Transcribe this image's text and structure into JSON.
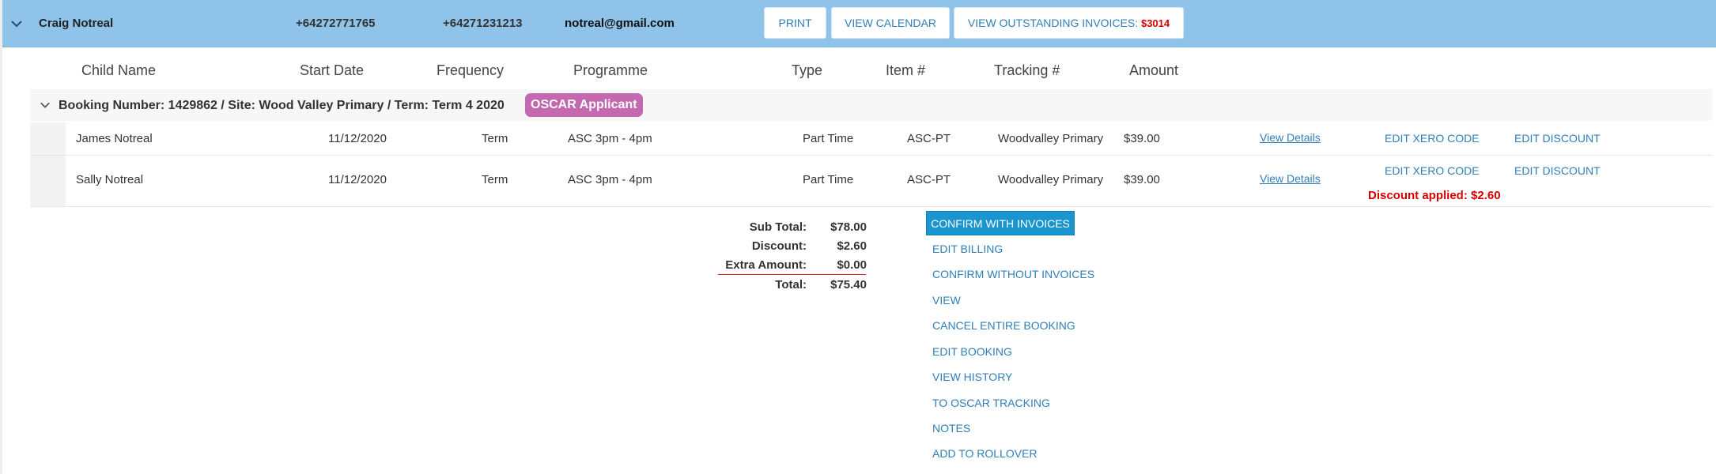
{
  "header": {
    "name": "Craig Notreal",
    "phone1": "+64272771765",
    "phone2": "+64271231213",
    "email": "notreal@gmail.com",
    "buttons": {
      "print": "PRINT",
      "view_calendar": "VIEW CALENDAR",
      "outstanding_label": "VIEW OUTSTANDING INVOICES:",
      "outstanding_amount": "$3014"
    }
  },
  "columns": [
    "Child Name",
    "Start Date",
    "Frequency",
    "Programme",
    "Type",
    "Item #",
    "Tracking #",
    "Amount"
  ],
  "booking": {
    "title": "Booking Number: 1429862 / Site: Wood Valley Primary / Term: Term 4 2020",
    "badge": "OSCAR Applicant"
  },
  "rows": [
    {
      "child": "James Notreal",
      "start_date": "11/12/2020",
      "frequency": "Term",
      "programme": "ASC 3pm - 4pm",
      "type": "Part Time",
      "item": "ASC-PT",
      "tracking": "Woodvalley Primary",
      "amount": "$39.00",
      "view_details": "View Details",
      "edit_xero": "EDIT XERO CODE",
      "edit_discount": "EDIT DISCOUNT"
    },
    {
      "child": "Sally Notreal",
      "start_date": "11/12/2020",
      "frequency": "Term",
      "programme": "ASC 3pm - 4pm",
      "type": "Part Time",
      "item": "ASC-PT",
      "tracking": "Woodvalley Primary",
      "amount": "$39.00",
      "view_details": "View Details",
      "edit_xero": "EDIT XERO CODE",
      "edit_discount": "EDIT DISCOUNT",
      "discount_applied": "Discount applied: $2.60"
    }
  ],
  "totals": {
    "sub_total_label": "Sub Total:",
    "sub_total": "$78.00",
    "discount_label": "Discount:",
    "discount": "$2.60",
    "extra_label": "Extra Amount:",
    "extra": "$0.00",
    "total_label": "Total:",
    "total": "$75.40"
  },
  "actions": {
    "confirm_with_invoices": "CONFIRM WITH INVOICES",
    "edit_billing": "EDIT BILLING",
    "confirm_without_invoices": "CONFIRM WITHOUT INVOICES",
    "view": "VIEW",
    "cancel_entire_booking": "CANCEL ENTIRE BOOKING",
    "edit_booking": "EDIT BOOKING",
    "view_history": "VIEW HISTORY",
    "to_oscar_tracking": "TO OSCAR TRACKING",
    "notes": "NOTES",
    "add_to_rollover": "ADD TO ROLLOVER"
  },
  "colors": {
    "header_bg": "#8fc3ea",
    "link": "#2f7fb7",
    "badge": "#c469b0",
    "alert": "#d40000",
    "primary_button": "#1a95d0"
  },
  "icons": {
    "header_toggle": "chevron-down-icon",
    "booking_toggle": "chevron-down-icon"
  }
}
